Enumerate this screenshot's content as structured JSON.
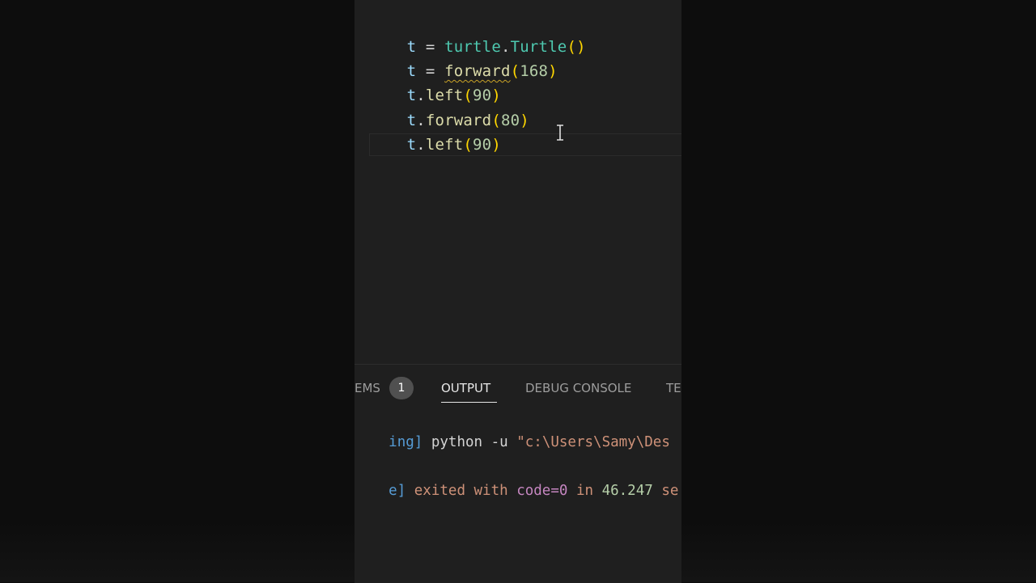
{
  "editor": {
    "lines": [
      {
        "t1": "t",
        "t2": " = ",
        "t3": "turtle",
        "t4": ".",
        "t5": "Turtle",
        "t6": "()"
      },
      {
        "t1": "t",
        "t2": " = ",
        "t3": "forward",
        "t4": "(",
        "t5": "168",
        "t6": ")"
      },
      {
        "t1": "t",
        "t2": ".",
        "t3": "left",
        "t4": "(",
        "t5": "90",
        "t6": ")"
      },
      {
        "t1": "t",
        "t2": ".",
        "t3": "forward",
        "t4": "(",
        "t5": "80",
        "t6": ")"
      },
      {
        "t1": "t",
        "t2": ".",
        "t3": "left",
        "t4": "(",
        "t5": "90",
        "t6": ")"
      }
    ]
  },
  "panel": {
    "tabs": {
      "problems_partial": "EMS",
      "problems_count": "1",
      "output": "OUTPUT",
      "debug_console": "DEBUG CONSOLE",
      "terminal_partial": "TE"
    },
    "output_lines": [
      {
        "prefix": "ing]",
        "cmd": " python -u ",
        "path": "\"c:\\Users\\Samy\\Des"
      },
      {
        "prefix": "e]",
        "text": " exited with ",
        "code": "code=0",
        "in": " in ",
        "secs": "46.247",
        "tail": " se"
      }
    ]
  },
  "icons": {
    "cursor": "text-cursor-icon"
  },
  "colors": {
    "editor_bg": "#1f1f1f",
    "letterbox_bg": "#0d0d0d",
    "active_tab": "#e7e7e7",
    "badge_bg": "#505050"
  }
}
